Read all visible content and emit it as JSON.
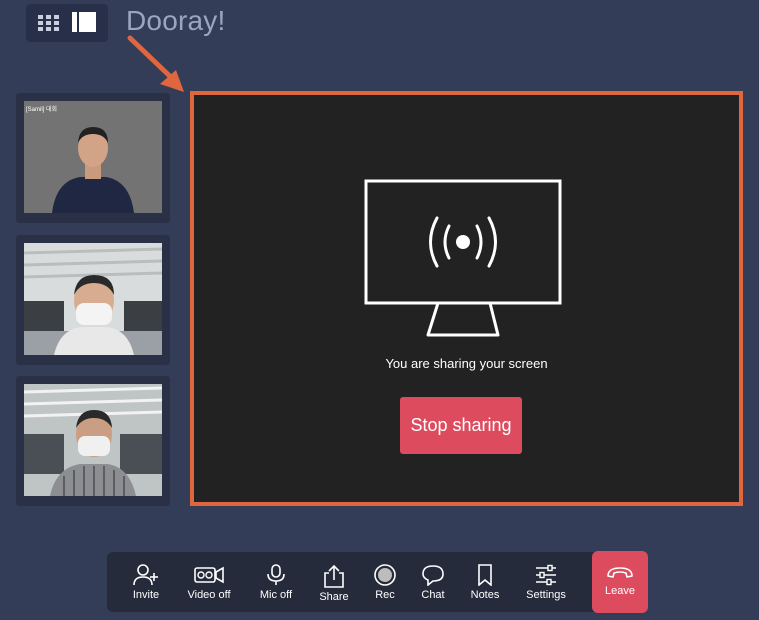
{
  "brand": {
    "name": "Dooray!"
  },
  "layout_switch": {
    "grid_icon": "grid-icon",
    "speaker_icon": "speaker-view-icon"
  },
  "participants": [
    {
      "tag": "[Samil] 대회",
      "icon": "video-feed"
    },
    {
      "icon": "video-feed"
    },
    {
      "icon": "video-feed"
    }
  ],
  "stage": {
    "message": "You are sharing your screen",
    "stop_label": "Stop sharing",
    "icon": "broadcast-monitor-icon"
  },
  "toolbar": {
    "invite": "Invite",
    "video_off": "Video off",
    "mic_off": "Mic off",
    "share": "Share",
    "rec": "Rec",
    "chat": "Chat",
    "notes": "Notes",
    "settings": "Settings",
    "leave": "Leave"
  },
  "colors": {
    "background": "#343d57",
    "highlight": "#e0663f",
    "danger": "#dc4c5e",
    "stage": "#222222",
    "toolbar": "#262b3b"
  }
}
